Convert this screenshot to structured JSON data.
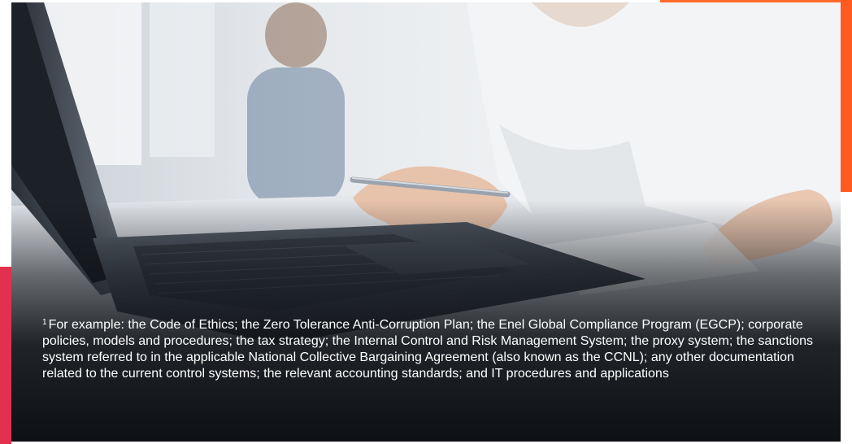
{
  "footnote": {
    "marker": "1",
    "text": "For example: the Code of Ethics; the Zero Tolerance Anti-Corruption Plan; the Enel Global Compliance Program (EGCP); corporate policies, models and procedures; the tax strategy; the Internal Control and Risk Management System; the proxy system; the sanctions system referred to in the applicable National Collective Bargaining Agreement (also known as the CCNL); any other documentation related to the current control systems; the relevant accounting standards; and IT procedures and applications"
  },
  "colors": {
    "accent_orange": "#ff5a1f",
    "accent_red": "#e2304e",
    "overlay": "#0d1014"
  }
}
